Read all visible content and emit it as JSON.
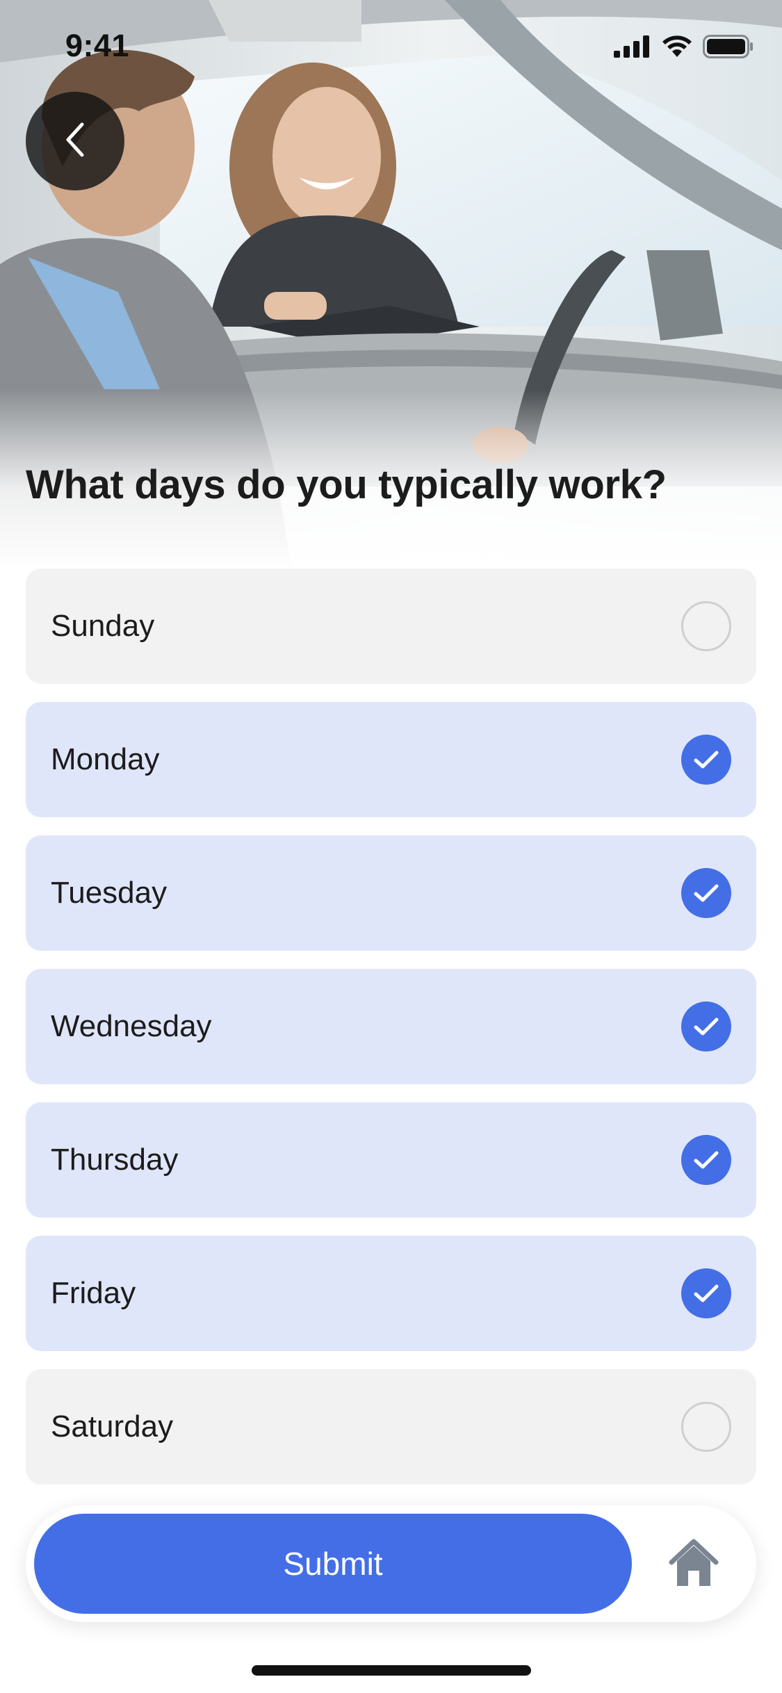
{
  "status_bar": {
    "time": "9:41",
    "icons": [
      "cellular-signal-icon",
      "wifi-icon",
      "battery-icon"
    ]
  },
  "hero": {
    "image": "photo of a smiling woman with a clipboard talking to a man in a car"
  },
  "header": {
    "back_icon": "chevron-left-icon"
  },
  "question": {
    "title": "What days do you typically work?"
  },
  "options": [
    {
      "label": "Sunday",
      "selected": false
    },
    {
      "label": "Monday",
      "selected": true
    },
    {
      "label": "Tuesday",
      "selected": true
    },
    {
      "label": "Wednesday",
      "selected": true
    },
    {
      "label": "Thursday",
      "selected": true
    },
    {
      "label": "Friday",
      "selected": true
    },
    {
      "label": "Saturday",
      "selected": false
    }
  ],
  "footer": {
    "submit_label": "Submit",
    "home_icon": "home-icon"
  },
  "colors": {
    "accent": "#436ee6",
    "selected_bg": "#e0e6fa",
    "unselected_bg": "#f2f2f2",
    "unchecked_border": "#cfcfcf"
  }
}
